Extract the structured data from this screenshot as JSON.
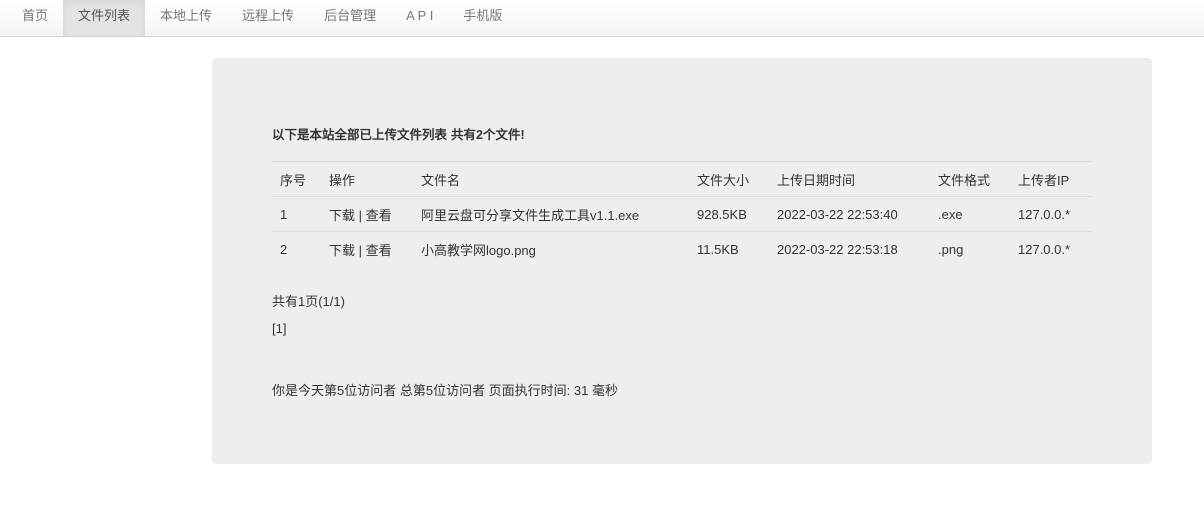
{
  "nav": {
    "items": [
      {
        "label": "首页"
      },
      {
        "label": "文件列表"
      },
      {
        "label": "本地上传"
      },
      {
        "label": "远程上传"
      },
      {
        "label": "后台管理"
      },
      {
        "label": "A P I"
      },
      {
        "label": "手机版"
      }
    ],
    "active_index": 1
  },
  "main": {
    "heading": "以下是本站全部已上传文件列表",
    "count_text": "共有2个文件!",
    "table": {
      "headers": [
        "序号",
        "操作",
        "文件名",
        "文件大小",
        "上传日期时间",
        "文件格式",
        "上传者IP"
      ],
      "rows": [
        {
          "no": "1",
          "download": "下载",
          "sep": "|",
          "view": "查看",
          "name": "阿里云盘可分享文件生成工具v1.1.exe",
          "size": "928.5KB",
          "date": "2022-03-22 22:53:40",
          "ext": ".exe",
          "ip": "127.0.0.*"
        },
        {
          "no": "2",
          "download": "下载",
          "sep": "|",
          "view": "查看",
          "name": "小高教学网logo.png",
          "size": "11.5KB",
          "date": "2022-03-22 22:53:18",
          "ext": ".png",
          "ip": "127.0.0.*"
        }
      ]
    },
    "page_info": "共有1页(1/1)",
    "pager_current": "[1]",
    "footer": "你是今天第5位访问者 总第5位访问者 页面执行时间: 31 毫秒"
  },
  "colors": {
    "well_background": "#eeeeee",
    "nav_active_background": "#e3e3e3",
    "text": "#333333",
    "nav_text": "#777777"
  }
}
